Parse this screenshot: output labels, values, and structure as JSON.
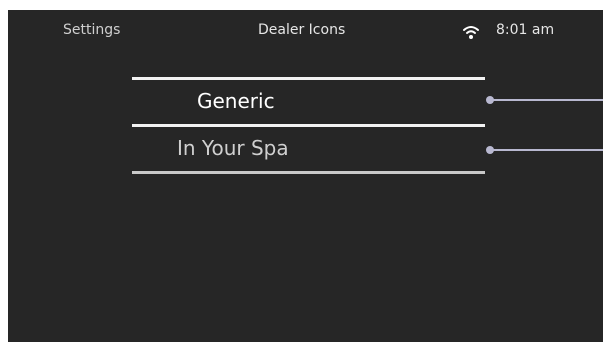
{
  "header": {
    "back_label": "Settings",
    "title": "Dealer Icons",
    "time": "8:01 am"
  },
  "list": {
    "items": [
      {
        "label": "Generic"
      },
      {
        "label": "In Your Spa"
      }
    ]
  },
  "colors": {
    "screen_background": "#262626",
    "selected_text": "#ffffff",
    "unselected_text": "#cfcfcf",
    "pointer": "#b8b8d0"
  },
  "icons": {
    "status": "wifi-icon"
  }
}
